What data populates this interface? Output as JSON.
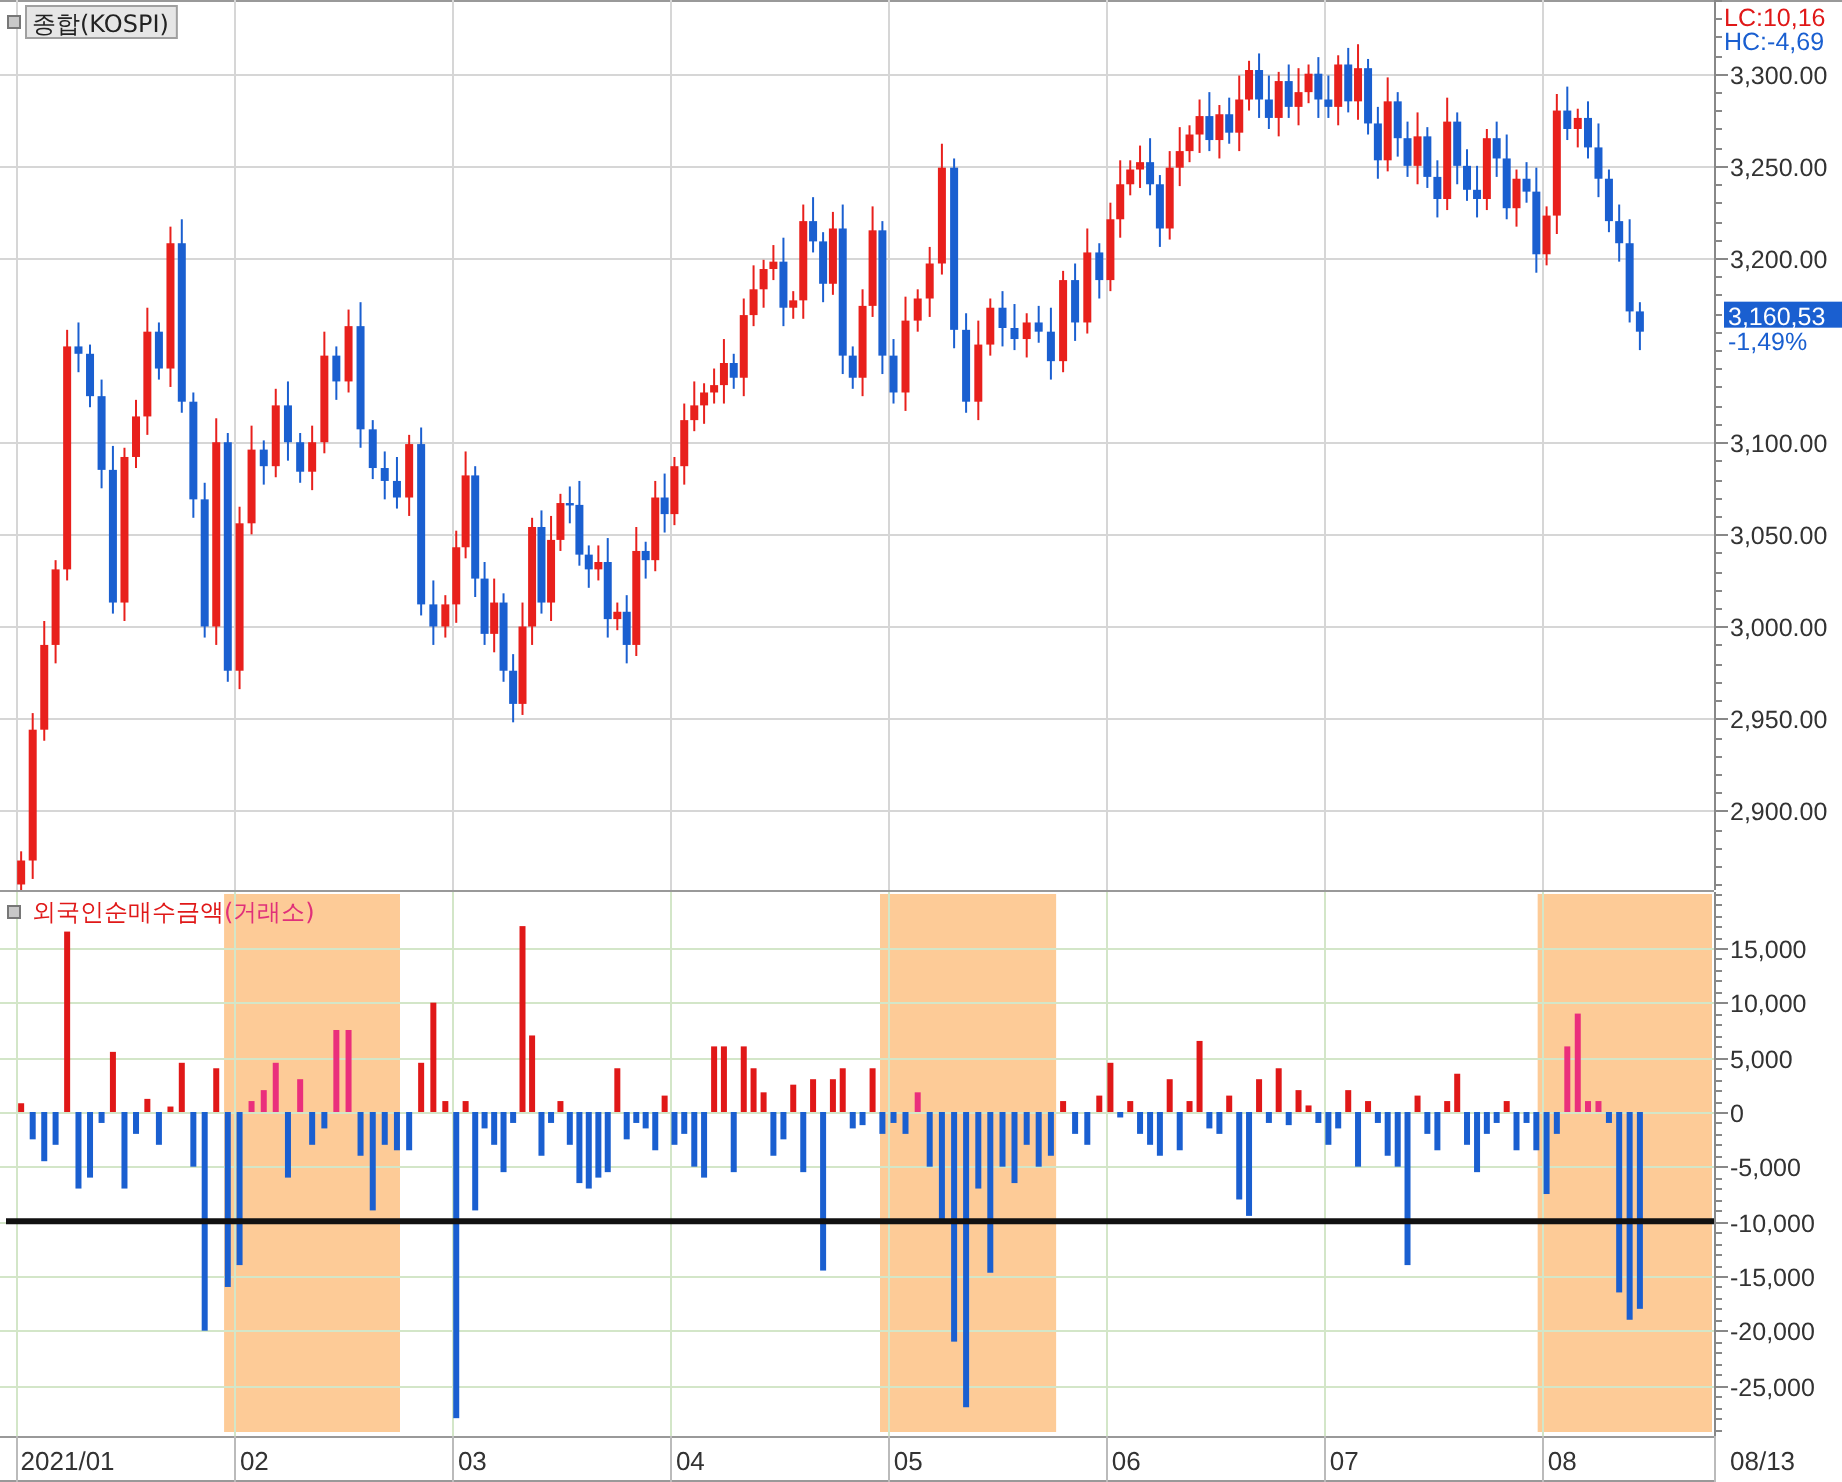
{
  "price_panel": {
    "info": [
      {
        "kind": "lc",
        "text": "LC:10,16"
      },
      {
        "kind": "hc",
        "text": "HC:-4,69"
      }
    ],
    "last_price": "3,160,53",
    "change": "-1,49%",
    "chart_data": {
      "type": "candlestick",
      "title": "종합(KOSPI)",
      "ylim": [
        2857,
        3340
      ],
      "xlim": [
        0.929,
        8.792
      ],
      "grid": true,
      "yticks": [
        {
          "value": 3300,
          "label": "3,300.00"
        },
        {
          "value": 3250,
          "label": "3,250.00"
        },
        {
          "value": 3200,
          "label": "3,200.00"
        },
        {
          "value": 3100,
          "label": "3,100.00"
        },
        {
          "value": 3050,
          "label": "3,050.00"
        },
        {
          "value": 3000,
          "label": "3,000.00"
        },
        {
          "value": 2950,
          "label": "2,950.00"
        },
        {
          "value": 2900,
          "label": "2,900.00"
        }
      ],
      "x": [
        1.026,
        1.079,
        1.132,
        1.184,
        1.237,
        1.289,
        1.342,
        1.395,
        1.447,
        1.5,
        1.553,
        1.605,
        1.658,
        1.711,
        1.763,
        1.816,
        1.868,
        1.921,
        1.974,
        2.028,
        2.083,
        2.139,
        2.194,
        2.25,
        2.306,
        2.361,
        2.417,
        2.472,
        2.528,
        2.583,
        2.639,
        2.694,
        2.75,
        2.806,
        2.861,
        2.917,
        2.972,
        3.022,
        3.065,
        3.109,
        3.152,
        3.196,
        3.239,
        3.283,
        3.326,
        3.37,
        3.413,
        3.457,
        3.5,
        3.543,
        3.587,
        3.63,
        3.674,
        3.717,
        3.761,
        3.804,
        3.848,
        3.891,
        3.935,
        3.978,
        4.023,
        4.068,
        4.114,
        4.159,
        4.205,
        4.25,
        4.295,
        4.341,
        4.386,
        4.432,
        4.477,
        4.523,
        4.568,
        4.614,
        4.659,
        4.705,
        4.75,
        4.795,
        4.841,
        4.886,
        4.932,
        4.977,
        5.028,
        5.083,
        5.139,
        5.194,
        5.25,
        5.306,
        5.361,
        5.417,
        5.472,
        5.528,
        5.583,
        5.639,
        5.694,
        5.75,
        5.806,
        5.861,
        5.917,
        5.972,
        6.023,
        6.068,
        6.114,
        6.159,
        6.205,
        6.25,
        6.295,
        6.341,
        6.386,
        6.432,
        6.477,
        6.523,
        6.568,
        6.614,
        6.659,
        6.705,
        6.75,
        6.795,
        6.841,
        6.886,
        6.932,
        6.977,
        7.023,
        7.068,
        7.114,
        7.159,
        7.205,
        7.25,
        7.295,
        7.341,
        7.386,
        7.432,
        7.477,
        7.523,
        7.568,
        7.614,
        7.659,
        7.705,
        7.75,
        7.795,
        7.841,
        7.886,
        7.932,
        7.977,
        8.024,
        8.071,
        8.119,
        8.167,
        8.214,
        8.262,
        8.31,
        8.357,
        8.405,
        8.452
      ],
      "ohlc": [
        [
          2860,
          2878,
          2854,
          2873
        ],
        [
          2873,
          2953,
          2863,
          2944
        ],
        [
          2944,
          3003,
          2938,
          2990
        ],
        [
          2990,
          3036,
          2980,
          3031
        ],
        [
          3031,
          3161,
          3025,
          3152
        ],
        [
          3152,
          3165,
          3138,
          3148
        ],
        [
          3148,
          3153,
          3119,
          3125
        ],
        [
          3125,
          3134,
          3075,
          3085
        ],
        [
          3085,
          3098,
          3007,
          3013
        ],
        [
          3013,
          3097,
          3003,
          3092
        ],
        [
          3092,
          3123,
          3086,
          3114
        ],
        [
          3114,
          3173,
          3104,
          3160
        ],
        [
          3160,
          3165,
          3134,
          3140
        ],
        [
          3140,
          3217,
          3130,
          3208
        ],
        [
          3208,
          3221,
          3116,
          3122
        ],
        [
          3122,
          3127,
          3059,
          3069
        ],
        [
          3069,
          3078,
          2994,
          3000
        ],
        [
          3000,
          3113,
          2990,
          3100
        ],
        [
          3100,
          3105,
          2970,
          2976
        ],
        [
          2976,
          3065,
          2966,
          3056
        ],
        [
          3056,
          3109,
          3050,
          3096
        ],
        [
          3096,
          3101,
          3077,
          3087
        ],
        [
          3087,
          3129,
          3081,
          3120
        ],
        [
          3120,
          3133,
          3090,
          3100
        ],
        [
          3100,
          3105,
          3078,
          3084
        ],
        [
          3084,
          3109,
          3074,
          3100
        ],
        [
          3100,
          3160,
          3094,
          3147
        ],
        [
          3147,
          3152,
          3123,
          3133
        ],
        [
          3133,
          3172,
          3127,
          3163
        ],
        [
          3163,
          3176,
          3097,
          3107
        ],
        [
          3107,
          3112,
          3080,
          3086
        ],
        [
          3086,
          3095,
          3069,
          3079
        ],
        [
          3079,
          3092,
          3064,
          3070
        ],
        [
          3070,
          3104,
          3060,
          3099
        ],
        [
          3099,
          3108,
          3006,
          3012
        ],
        [
          3012,
          3025,
          2990,
          3000
        ],
        [
          3000,
          3017,
          2994,
          3012
        ],
        [
          3012,
          3052,
          3002,
          3043
        ],
        [
          3043,
          3095,
          3037,
          3082
        ],
        [
          3082,
          3087,
          3016,
          3026
        ],
        [
          3026,
          3035,
          2990,
          2996
        ],
        [
          2996,
          3026,
          2986,
          3013
        ],
        [
          3013,
          3018,
          2970,
          2976
        ],
        [
          2976,
          2985,
          2948,
          2958
        ],
        [
          2958,
          3013,
          2952,
          3000
        ],
        [
          3000,
          3059,
          2990,
          3054
        ],
        [
          3054,
          3063,
          3007,
          3013
        ],
        [
          3013,
          3060,
          3003,
          3047
        ],
        [
          3047,
          3072,
          3041,
          3067
        ],
        [
          3067,
          3076,
          3056,
          3066
        ],
        [
          3066,
          3079,
          3033,
          3039
        ],
        [
          3039,
          3044,
          3021,
          3031
        ],
        [
          3031,
          3044,
          3025,
          3035
        ],
        [
          3035,
          3048,
          2994,
          3004
        ],
        [
          3004,
          3013,
          2998,
          3008
        ],
        [
          3008,
          3017,
          2980,
          2990
        ],
        [
          2990,
          3054,
          2984,
          3041
        ],
        [
          3041,
          3046,
          3026,
          3036
        ],
        [
          3036,
          3079,
          3030,
          3070
        ],
        [
          3070,
          3083,
          3051,
          3061
        ],
        [
          3061,
          3092,
          3055,
          3087
        ],
        [
          3087,
          3121,
          3077,
          3112
        ],
        [
          3112,
          3133,
          3106,
          3120
        ],
        [
          3120,
          3132,
          3110,
          3127
        ],
        [
          3127,
          3140,
          3121,
          3131
        ],
        [
          3131,
          3156,
          3121,
          3143
        ],
        [
          3143,
          3148,
          3129,
          3135
        ],
        [
          3135,
          3178,
          3125,
          3169
        ],
        [
          3169,
          3196,
          3163,
          3183
        ],
        [
          3183,
          3199,
          3173,
          3194
        ],
        [
          3194,
          3207,
          3188,
          3198
        ],
        [
          3198,
          3211,
          3163,
          3173
        ],
        [
          3173,
          3182,
          3167,
          3177
        ],
        [
          3177,
          3229,
          3167,
          3220
        ],
        [
          3220,
          3233,
          3203,
          3209
        ],
        [
          3209,
          3214,
          3176,
          3186
        ],
        [
          3186,
          3225,
          3180,
          3216
        ],
        [
          3216,
          3229,
          3137,
          3147
        ],
        [
          3147,
          3152,
          3129,
          3135
        ],
        [
          3135,
          3183,
          3125,
          3174
        ],
        [
          3174,
          3228,
          3168,
          3215
        ],
        [
          3215,
          3220,
          3137,
          3147
        ],
        [
          3147,
          3156,
          3121,
          3127
        ],
        [
          3127,
          3179,
          3117,
          3166
        ],
        [
          3166,
          3183,
          3160,
          3178
        ],
        [
          3178,
          3206,
          3168,
          3197
        ],
        [
          3197,
          3262,
          3191,
          3249
        ],
        [
          3249,
          3254,
          3151,
          3161
        ],
        [
          3161,
          3170,
          3116,
          3122
        ],
        [
          3122,
          3166,
          3112,
          3153
        ],
        [
          3153,
          3178,
          3147,
          3173
        ],
        [
          3173,
          3182,
          3152,
          3162
        ],
        [
          3162,
          3175,
          3150,
          3156
        ],
        [
          3156,
          3170,
          3146,
          3165
        ],
        [
          3165,
          3174,
          3154,
          3160
        ],
        [
          3160,
          3173,
          3134,
          3144
        ],
        [
          3144,
          3193,
          3138,
          3188
        ],
        [
          3188,
          3197,
          3155,
          3165
        ],
        [
          3165,
          3216,
          3159,
          3203
        ],
        [
          3203,
          3208,
          3178,
          3188
        ],
        [
          3188,
          3230,
          3182,
          3221
        ],
        [
          3221,
          3253,
          3211,
          3240
        ],
        [
          3240,
          3253,
          3234,
          3248
        ],
        [
          3248,
          3261,
          3238,
          3252
        ],
        [
          3252,
          3265,
          3234,
          3240
        ],
        [
          3240,
          3245,
          3206,
          3216
        ],
        [
          3216,
          3258,
          3210,
          3249
        ],
        [
          3249,
          3271,
          3239,
          3258
        ],
        [
          3258,
          3272,
          3252,
          3267
        ],
        [
          3267,
          3286,
          3257,
          3277
        ],
        [
          3277,
          3290,
          3258,
          3264
        ],
        [
          3264,
          3283,
          3254,
          3278
        ],
        [
          3278,
          3287,
          3262,
          3268
        ],
        [
          3268,
          3299,
          3258,
          3286
        ],
        [
          3286,
          3307,
          3280,
          3302
        ],
        [
          3302,
          3311,
          3276,
          3286
        ],
        [
          3286,
          3299,
          3270,
          3276
        ],
        [
          3276,
          3301,
          3266,
          3296
        ],
        [
          3296,
          3305,
          3276,
          3282
        ],
        [
          3282,
          3303,
          3272,
          3290
        ],
        [
          3290,
          3305,
          3284,
          3300
        ],
        [
          3300,
          3309,
          3276,
          3286
        ],
        [
          3286,
          3299,
          3276,
          3282
        ],
        [
          3282,
          3310,
          3272,
          3305
        ],
        [
          3305,
          3314,
          3279,
          3285
        ],
        [
          3285,
          3316,
          3275,
          3303
        ],
        [
          3303,
          3308,
          3267,
          3273
        ],
        [
          3273,
          3282,
          3243,
          3253
        ],
        [
          3253,
          3298,
          3247,
          3285
        ],
        [
          3285,
          3290,
          3255,
          3265
        ],
        [
          3265,
          3274,
          3244,
          3250
        ],
        [
          3250,
          3279,
          3240,
          3266
        ],
        [
          3266,
          3271,
          3238,
          3244
        ],
        [
          3244,
          3253,
          3222,
          3232
        ],
        [
          3232,
          3287,
          3226,
          3274
        ],
        [
          3274,
          3279,
          3240,
          3250
        ],
        [
          3250,
          3259,
          3231,
          3237
        ],
        [
          3237,
          3250,
          3222,
          3232
        ],
        [
          3232,
          3270,
          3226,
          3265
        ],
        [
          3265,
          3274,
          3244,
          3254
        ],
        [
          3254,
          3267,
          3221,
          3227
        ],
        [
          3227,
          3248,
          3217,
          3243
        ],
        [
          3243,
          3252,
          3230,
          3236
        ],
        [
          3236,
          3249,
          3192,
          3202
        ],
        [
          3202,
          3228,
          3196,
          3223
        ],
        [
          3223,
          3289,
          3213,
          3280
        ],
        [
          3280,
          3293,
          3264,
          3270
        ],
        [
          3270,
          3281,
          3260,
          3276
        ],
        [
          3276,
          3285,
          3254,
          3260
        ],
        [
          3260,
          3273,
          3233,
          3243
        ],
        [
          3243,
          3248,
          3214,
          3220
        ],
        [
          3220,
          3229,
          3198,
          3208
        ],
        [
          3208,
          3221,
          3165,
          3171
        ],
        [
          3171,
          3176,
          3150,
          3160
        ]
      ]
    }
  },
  "flow_panel": {
    "market": "(거래소)",
    "chart_data": {
      "type": "bar",
      "title": "외국인순매수금액",
      "ylim": [
        -29630,
        20120
      ],
      "xlim": [
        0.929,
        8.792
      ],
      "grid": true,
      "xticks": [
        {
          "value": 1.239,
          "label": "2021/01"
        },
        {
          "value": 2.096,
          "label": "02"
        },
        {
          "value": 3.096,
          "label": "03"
        },
        {
          "value": 4.096,
          "label": "04"
        },
        {
          "value": 5.096,
          "label": "05"
        },
        {
          "value": 6.096,
          "label": "06"
        },
        {
          "value": 7.096,
          "label": "07"
        },
        {
          "value": 8.096,
          "label": "08"
        }
      ],
      "yticks": [
        {
          "value": 15000,
          "label": "15,000"
        },
        {
          "value": 10000,
          "label": "10,000"
        },
        {
          "value": 5000,
          "label": "5,000"
        },
        {
          "value": 0,
          "label": "0"
        },
        {
          "value": -5000,
          "label": "-5,000"
        },
        {
          "value": -10000,
          "label": "-10,000"
        },
        {
          "value": -15000,
          "label": "-15,000"
        },
        {
          "value": -20000,
          "label": "-20,000"
        },
        {
          "value": -25000,
          "label": "-25,000"
        }
      ],
      "bands": [
        {
          "axis": "x",
          "from": 1.957,
          "to": 2.764
        },
        {
          "axis": "x",
          "from": 4.966,
          "to": 5.774
        },
        {
          "axis": "x",
          "from": 7.983,
          "to": 8.792
        }
      ],
      "ref_lines": [
        {
          "axis": "y",
          "value": -10000
        }
      ],
      "x": [
        1.026,
        1.079,
        1.132,
        1.184,
        1.237,
        1.289,
        1.342,
        1.395,
        1.447,
        1.5,
        1.553,
        1.605,
        1.658,
        1.711,
        1.763,
        1.816,
        1.868,
        1.921,
        1.974,
        2.028,
        2.083,
        2.139,
        2.194,
        2.25,
        2.306,
        2.361,
        2.417,
        2.472,
        2.528,
        2.583,
        2.639,
        2.694,
        2.75,
        2.806,
        2.861,
        2.917,
        2.972,
        3.022,
        3.065,
        3.109,
        3.152,
        3.196,
        3.239,
        3.283,
        3.326,
        3.37,
        3.413,
        3.457,
        3.5,
        3.543,
        3.587,
        3.63,
        3.674,
        3.717,
        3.761,
        3.804,
        3.848,
        3.891,
        3.935,
        3.978,
        4.023,
        4.068,
        4.114,
        4.159,
        4.205,
        4.25,
        4.295,
        4.341,
        4.386,
        4.432,
        4.477,
        4.523,
        4.568,
        4.614,
        4.659,
        4.705,
        4.75,
        4.795,
        4.841,
        4.886,
        4.932,
        4.977,
        5.028,
        5.083,
        5.139,
        5.194,
        5.25,
        5.306,
        5.361,
        5.417,
        5.472,
        5.528,
        5.583,
        5.639,
        5.694,
        5.75,
        5.806,
        5.861,
        5.917,
        5.972,
        6.023,
        6.068,
        6.114,
        6.159,
        6.205,
        6.25,
        6.295,
        6.341,
        6.386,
        6.432,
        6.477,
        6.523,
        6.568,
        6.614,
        6.659,
        6.705,
        6.75,
        6.795,
        6.841,
        6.886,
        6.932,
        6.977,
        7.023,
        7.068,
        7.114,
        7.159,
        7.205,
        7.25,
        7.295,
        7.341,
        7.386,
        7.432,
        7.477,
        7.523,
        7.568,
        7.614,
        7.659,
        7.705,
        7.75,
        7.795,
        7.841,
        7.886,
        7.932,
        7.977,
        8.024,
        8.071,
        8.119,
        8.167,
        8.214,
        8.262,
        8.31,
        8.357,
        8.405,
        8.452
      ],
      "values": [
        800,
        -2500,
        -4500,
        -3000,
        16500,
        -7000,
        -6000,
        -1000,
        5500,
        -7000,
        -2000,
        1200,
        -3000,
        500,
        4500,
        -5000,
        -20000,
        4000,
        -16000,
        -14000,
        1000,
        2000,
        4500,
        -6000,
        3000,
        -3000,
        -1500,
        7500,
        7500,
        -4000,
        -9000,
        -3000,
        -3500,
        -3500,
        4500,
        10000,
        1000,
        -28000,
        1000,
        -9000,
        -1500,
        -3000,
        -5500,
        -1000,
        17000,
        7000,
        -4000,
        -1000,
        1000,
        -3000,
        -6500,
        -7000,
        -6000,
        -5500,
        4000,
        -2500,
        -1000,
        -1500,
        -3500,
        1500,
        -3000,
        -2000,
        -5000,
        -6000,
        6000,
        6000,
        -5500,
        6000,
        4000,
        1800,
        -4000,
        -2500,
        2500,
        -5500,
        3000,
        -14500,
        3000,
        4000,
        -1500,
        -1200,
        4000,
        -2000,
        -1000,
        -2000,
        1800,
        -5000,
        -10000,
        -21000,
        -27000,
        -7000,
        -14700,
        -5000,
        -6500,
        -3000,
        -5000,
        -4000,
        1000,
        -2000,
        -3000,
        1500,
        4500,
        -500,
        1000,
        -2000,
        -3000,
        -4000,
        3000,
        -3500,
        1000,
        6500,
        -1500,
        -2000,
        1500,
        -8000,
        -9500,
        3000,
        -1000,
        4000,
        -1200,
        2000,
        600,
        -1000,
        -3000,
        -1500,
        2000,
        -5000,
        1000,
        -1000,
        -4000,
        -5000,
        -14000,
        1500,
        -2000,
        -3500,
        1000,
        3500,
        -3000,
        -5500,
        -2000,
        -1000,
        1000,
        -3500,
        -1000,
        -3500,
        -7500,
        -2000,
        6000,
        9000,
        1000,
        1000,
        -1000,
        -16500,
        -19000,
        -18000
      ]
    }
  },
  "date_axis": {
    "end_label": "08/13"
  }
}
